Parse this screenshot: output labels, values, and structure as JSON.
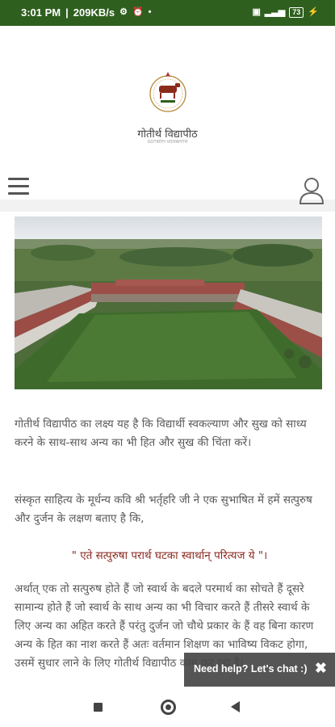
{
  "status_bar": {
    "time": "3:01 PM",
    "speed": "209KB/s",
    "battery": "73"
  },
  "header": {
    "brand_name": "गोतीर्थ विद्यापीठ",
    "brand_subtitle": "GOTIRTH VIDYAPITH",
    "menu_icon": "hamburger-menu-icon",
    "user_icon": "user-account-icon"
  },
  "colors": {
    "status_bar": "#2e5f1e",
    "quote_text": "#8b2b22",
    "body_text": "#5a5a5a"
  },
  "article": {
    "para1": "गोतीर्थ विद्यापीठ का लक्ष्य यह है कि विद्यार्थी स्वकल्याण और सुख को साध्य करने के साथ-साथ अन्य का भी हित और सुख की चिंता करें।",
    "para2": "संस्कृत साहित्य के मूर्धन्य कवि श्री भर्तृहरि जी ने एक सुभाषित में हमें सत्पुरुष और दुर्जन के लक्षण बताए है कि,",
    "quote": "\" एते सत्पुरुषा परार्थ घटका स्वार्थान् परित्यज ये \"।",
    "para3": "अर्थात् एक तो सत्पुरुष होते हैं जो स्वार्थ के बदले परमार्थ का सोचते हैं दूसरे सामान्य होते हैं जो स्वार्थ के साथ अन्य का भी विचार करते हैं तीसरे स्वार्थ के लिए अन्य का अहित करते हैं परंतु दुर्जन जो चौथे प्रकार के हैं वह बिना कारण अन्य के हित का नाश करते हैं अतः वर्तमान शिक्षण का भाविष्य विकट होगा, उसमें सुधार लाने के लिए गोतीर्थ विद्यापीठ काम कर रहा है।"
  },
  "chat_widget": {
    "label": "Need help? Let's chat :)",
    "close": "✖"
  }
}
